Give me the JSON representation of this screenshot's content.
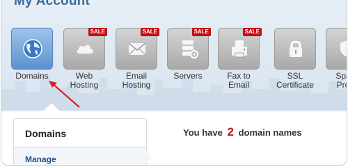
{
  "page": {
    "title": "My Account"
  },
  "products": [
    {
      "label": "Domains",
      "icon": "globe-icon",
      "sale": "",
      "active": true
    },
    {
      "label": "Web Hosting",
      "icon": "cloud-icon",
      "sale": "SALE",
      "active": false
    },
    {
      "label": "Email Hosting",
      "icon": "envelope-icon",
      "sale": "SALE",
      "active": false
    },
    {
      "label": "Servers",
      "icon": "server-icon",
      "sale": "SALE",
      "active": false
    },
    {
      "label": "Fax to Email",
      "icon": "fax-icon",
      "sale": "SALE",
      "active": false
    },
    {
      "label": "SSL Certificate",
      "icon": "lock-icon",
      "sale": "",
      "active": false
    },
    {
      "label": "Spam Prote",
      "icon": "shield-icon",
      "sale": "",
      "active": false
    }
  ],
  "sidebar": {
    "title": "Domains",
    "manage_label": "Manage"
  },
  "summary": {
    "prefix": "You have",
    "count": "2",
    "suffix": "domain names"
  },
  "colors": {
    "accent": "#3a6e9c",
    "sale": "#c40d12",
    "count": "#c01b1b",
    "arrow": "#d32020"
  }
}
